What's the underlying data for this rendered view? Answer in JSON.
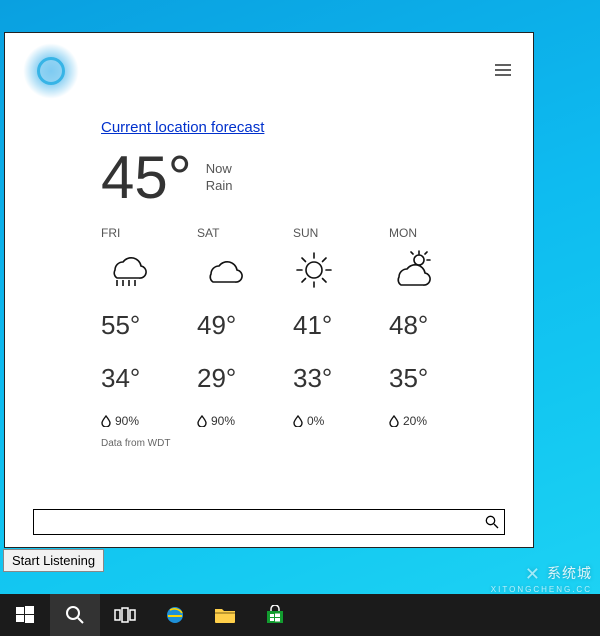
{
  "cortana": {
    "forecast_link": "Current location forecast",
    "current": {
      "temp": "45°",
      "now_label": "Now",
      "condition": "Rain"
    },
    "days": [
      {
        "label": "FRI",
        "icon": "rain",
        "hi": "55°",
        "lo": "34°",
        "precip": "90%"
      },
      {
        "label": "SAT",
        "icon": "cloud",
        "hi": "49°",
        "lo": "29°",
        "precip": "90%"
      },
      {
        "label": "SUN",
        "icon": "sun",
        "hi": "41°",
        "lo": "33°",
        "precip": "0%"
      },
      {
        "label": "MON",
        "icon": "partly-cloudy",
        "hi": "48°",
        "lo": "35°",
        "precip": "20%"
      }
    ],
    "attribution": "Data from WDT",
    "search_placeholder": "",
    "start_listening_label": "Start Listening"
  },
  "taskbar": {
    "items": [
      {
        "name": "start-button",
        "icon": "windows"
      },
      {
        "name": "search-button",
        "icon": "search"
      },
      {
        "name": "task-view-button",
        "icon": "taskview"
      },
      {
        "name": "internet-explorer",
        "icon": "ie"
      },
      {
        "name": "file-explorer",
        "icon": "folder"
      },
      {
        "name": "windows-store",
        "icon": "store"
      }
    ]
  },
  "watermark": {
    "brand": "系统城",
    "sub": "XITONGCHENG.CC"
  }
}
